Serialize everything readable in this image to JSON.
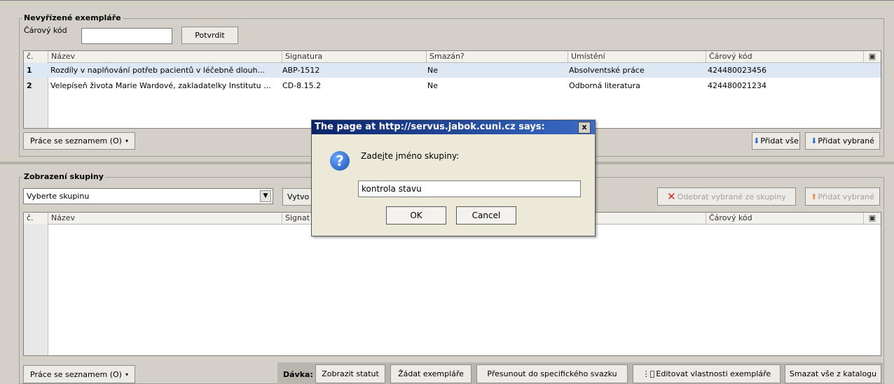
{
  "pending": {
    "title": "Nevyřízené exempláře",
    "barcode_label": "Čárový kód",
    "barcode_value": "",
    "confirm_label": "Potvrdit",
    "columns": [
      "č.",
      "Název",
      "Signatura",
      "Smazán?",
      "Umístění",
      "Čárový kód"
    ],
    "rows": [
      {
        "num": "1",
        "name": "Rozdíly v naplňování potřeb pacientů v léčebně dlouh...",
        "signature": "ABP-1512",
        "deleted": "Ne",
        "location": "Absolventské práce",
        "barcode": "424480023456"
      },
      {
        "num": "2",
        "name": "Velepíseň života Marie Wardové, zakladatelky Institutu ...",
        "signature": "CD-8.15.2",
        "deleted": "Ne",
        "location": "Odborná literatura",
        "barcode": "424480021234"
      }
    ],
    "list_work_label": "Práce se seznamem (O)",
    "add_all_label": "Přidat vše",
    "add_selected_label": "Přidat vybrané"
  },
  "group": {
    "title": "Zobrazení skupiny",
    "select_value": "Vyberte skupinu",
    "create_label": "Vytvo",
    "remove_label": "Odebrat vybrané ze skupiny",
    "add_selected_label": "Přidat vybrané",
    "columns": [
      "č.",
      "Název",
      "Signat",
      "ění",
      "Čárový kód"
    ],
    "list_work_label": "Práce se seznamem (O)"
  },
  "bottom_toolbar": {
    "batch_label": "Dávka:",
    "show_status": "Zobrazit statut",
    "request": "Žádat exempláře",
    "move": "Přesunout do specifického svazku",
    "edit": "Editovat vlastnosti exempláře",
    "delete": "Smazat vše z katalogu"
  },
  "dialog": {
    "title": "The page at http://servus.jabok.cuni.cz says:",
    "message": "Zadejte jméno skupiny:",
    "input_value": "kontrola stavu",
    "ok": "OK",
    "cancel": "Cancel",
    "close": "x"
  },
  "colors": {
    "background": "#d4d0c8",
    "titlebar": "#0a246a",
    "remove_icon": "#d0281a",
    "add_icon": "#2a6acb"
  },
  "icons": [
    "chevron-down-icon",
    "column-picker-icon",
    "arrow-down-icon",
    "x-remove-icon",
    "arrow-up-icon",
    "question-icon",
    "edit-icon"
  ]
}
